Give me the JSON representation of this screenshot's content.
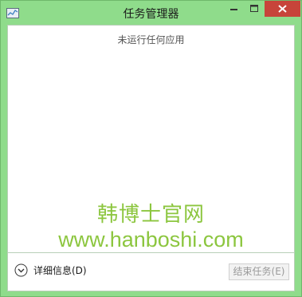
{
  "window": {
    "title": "任务管理器"
  },
  "content": {
    "empty_message": "未运行任何应用",
    "watermark_cn": "韩博士官网",
    "watermark_url": "www.hanboshi.com"
  },
  "footer": {
    "details_label": "详细信息(D)",
    "end_task_label": "结束任务(E)"
  },
  "colors": {
    "frame": "#8fdc8b",
    "close_button": "#c7443a",
    "watermark": "#8cc63f"
  },
  "icons": {
    "app": "task-manager-icon",
    "minimize": "minimize-icon",
    "maximize": "maximize-icon",
    "close": "close-icon",
    "expand": "chevron-down-circle-icon"
  }
}
